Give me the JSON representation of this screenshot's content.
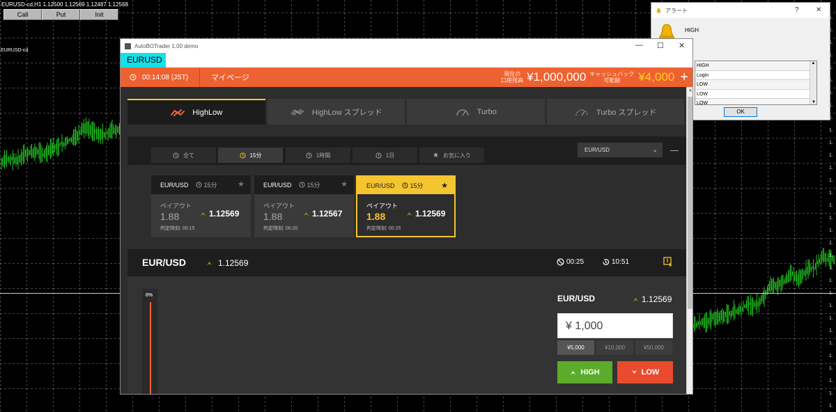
{
  "mt4": {
    "header": "EURUSD-cd,H1  1.12500 1.12569 1.12487 1.12568",
    "buttons": [
      "Call",
      "Put",
      "Init"
    ],
    "symbol_label": "EURUSD-cd",
    "axis_label": "1.",
    "bull_color": "#1fbf1f"
  },
  "alert": {
    "title": "アラート",
    "help": "?",
    "close": "✕",
    "message": "HIGH",
    "list": [
      "HIGH",
      "Login",
      "LOW",
      "LOW",
      "LOW"
    ],
    "ok": "OK",
    "icon": "bell-icon"
  },
  "app": {
    "window_title": "AutoBOTrader 1.00 demo",
    "controls": [
      "—",
      "☐",
      "✕"
    ],
    "symbol": "EURUSD",
    "topbar": {
      "time": "00:14:08 (JST)",
      "mypage": "マイページ",
      "balance_label_1": "現在の",
      "balance_label_2": "口座残高",
      "balance": "¥1,000,000",
      "cashback_label_1": "キャッシュバック",
      "cashback_label_2": "可能額",
      "cashback": "¥4,000",
      "plus": "+",
      "accent": "#ee6130"
    },
    "tabs": [
      {
        "label": "HighLow",
        "icon": "highlow-icon"
      },
      {
        "label": "HighLow スプレッド",
        "icon": "spread-icon"
      },
      {
        "label": "Turbo",
        "icon": "gauge-icon"
      },
      {
        "label": "Turbo スプレッド",
        "icon": "gauge-dashed-icon"
      }
    ],
    "filters": [
      "全て",
      "15分",
      "1時間",
      "1日",
      "お気に入り"
    ],
    "dropdown": "EUR/USD",
    "cards": [
      {
        "pair": "EUR/USD",
        "duration": "15分",
        "payout_label": "ペイアウト",
        "payout": "1.88",
        "rate": "1.12569",
        "judge": "判定時刻: 00:15"
      },
      {
        "pair": "EUR/USD",
        "duration": "15分",
        "payout_label": "ペイアウト",
        "payout": "1.88",
        "rate": "1.12567",
        "judge": "判定時刻: 00:20"
      },
      {
        "pair": "EUR/USD",
        "duration": "15分",
        "payout_label": "ペイアウト",
        "payout": "1.88",
        "rate": "1.12569",
        "judge": "判定時刻: 00:25"
      }
    ],
    "pairbar": {
      "name": "EUR/USD",
      "rate": "1.12569",
      "countdown": "00:25",
      "remaining": "10:51"
    },
    "chart": {
      "pct": "0%"
    },
    "trade": {
      "pair": "EUR/USD",
      "rate": "1.12569",
      "amount": "¥ 1,000",
      "presets": [
        "¥5,000",
        "¥10,000",
        "¥50,000"
      ],
      "high": "HIGH",
      "low": "LOW",
      "high_color": "#5cab2b",
      "low_color": "#e84b2d"
    }
  }
}
